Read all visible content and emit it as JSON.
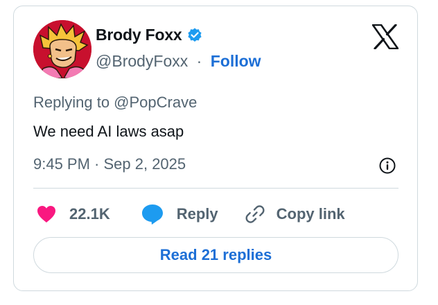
{
  "user": {
    "display_name": "Brody Foxx",
    "handle": "@BrodyFoxx",
    "separator": "·",
    "follow_label": "Follow",
    "verified": true
  },
  "tweet": {
    "replying_to": "Replying to @PopCrave",
    "text": "We need AI laws asap",
    "timestamp": "9:45 PM · Sep 2, 2025"
  },
  "actions": {
    "like_count": "22.1K",
    "reply_label": "Reply",
    "copy_label": "Copy link"
  },
  "read_replies_label": "Read 21 replies",
  "icons": {
    "logo": "x-logo-icon",
    "verified": "verified-badge-icon",
    "info": "info-icon",
    "like": "heart-icon",
    "reply": "speech-bubble-icon",
    "copy": "link-icon"
  },
  "colors": {
    "accent": "#1d6fd6",
    "heart": "#f91880",
    "verified": "#1d9bf0",
    "muted_text": "#536471",
    "border": "#cfd9de"
  }
}
